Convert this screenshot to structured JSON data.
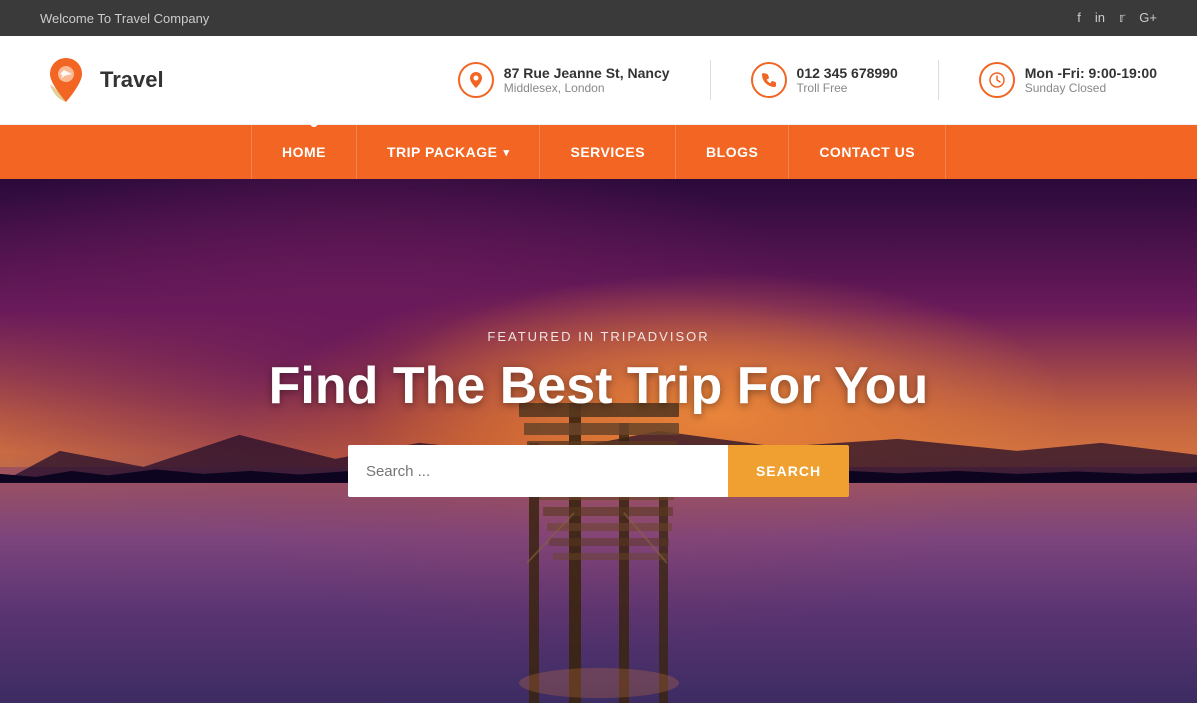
{
  "topbar": {
    "welcome": "Welcome To Travel Company",
    "social": [
      "f",
      "in",
      "🐦",
      "G+"
    ]
  },
  "header": {
    "logo_text": "Travel",
    "contacts": [
      {
        "icon": "location",
        "main": "87 Rue Jeanne St, Nancy",
        "sub": "Middlesex, London"
      },
      {
        "icon": "phone",
        "main": "012 345 678990",
        "sub": "Troll Free"
      },
      {
        "icon": "clock",
        "main": "Mon -Fri: 9:00-19:00",
        "sub": "Sunday Closed"
      }
    ]
  },
  "nav": {
    "items": [
      {
        "label": "HOME",
        "dropdown": false
      },
      {
        "label": "TRIP PACKAGE",
        "dropdown": true
      },
      {
        "label": "SERVICES",
        "dropdown": false
      },
      {
        "label": "BLOGS",
        "dropdown": false
      },
      {
        "label": "CONTACT US",
        "dropdown": false
      }
    ]
  },
  "hero": {
    "featured": "FEATURED IN TRIPADVISOR",
    "title": "Find The Best Trip For You",
    "search_placeholder": "Search ...",
    "search_button": "SEARCH"
  },
  "colors": {
    "orange": "#f26522",
    "nav_bg": "#f26522",
    "search_btn": "#f0a030",
    "top_bar": "#3a3a3a"
  }
}
